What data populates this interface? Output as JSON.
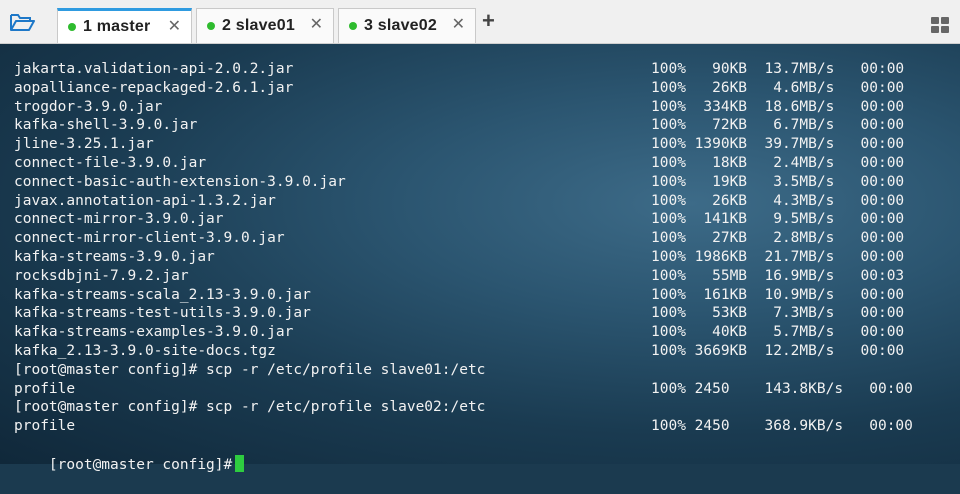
{
  "tabs": [
    {
      "label": "1 master",
      "active": true
    },
    {
      "label": "2 slave01",
      "active": false
    },
    {
      "label": "3 slave02",
      "active": false
    }
  ],
  "terminal": {
    "lines": [
      {
        "name": "jakarta.validation-api-2.0.2.jar",
        "stats": "100%   90KB  13.7MB/s   00:00"
      },
      {
        "name": "aopalliance-repackaged-2.6.1.jar",
        "stats": "100%   26KB   4.6MB/s   00:00"
      },
      {
        "name": "trogdor-3.9.0.jar",
        "stats": "100%  334KB  18.6MB/s   00:00"
      },
      {
        "name": "kafka-shell-3.9.0.jar",
        "stats": "100%   72KB   6.7MB/s   00:00"
      },
      {
        "name": "jline-3.25.1.jar",
        "stats": "100% 1390KB  39.7MB/s   00:00"
      },
      {
        "name": "connect-file-3.9.0.jar",
        "stats": "100%   18KB   2.4MB/s   00:00"
      },
      {
        "name": "connect-basic-auth-extension-3.9.0.jar",
        "stats": "100%   19KB   3.5MB/s   00:00"
      },
      {
        "name": "javax.annotation-api-1.3.2.jar",
        "stats": "100%   26KB   4.3MB/s   00:00"
      },
      {
        "name": "connect-mirror-3.9.0.jar",
        "stats": "100%  141KB   9.5MB/s   00:00"
      },
      {
        "name": "connect-mirror-client-3.9.0.jar",
        "stats": "100%   27KB   2.8MB/s   00:00"
      },
      {
        "name": "kafka-streams-3.9.0.jar",
        "stats": "100% 1986KB  21.7MB/s   00:00"
      },
      {
        "name": "rocksdbjni-7.9.2.jar",
        "stats": "100%   55MB  16.9MB/s   00:03"
      },
      {
        "name": "kafka-streams-scala_2.13-3.9.0.jar",
        "stats": "100%  161KB  10.9MB/s   00:00"
      },
      {
        "name": "kafka-streams-test-utils-3.9.0.jar",
        "stats": "100%   53KB   7.3MB/s   00:00"
      },
      {
        "name": "kafka-streams-examples-3.9.0.jar",
        "stats": "100%   40KB   5.7MB/s   00:00"
      },
      {
        "name": "kafka_2.13-3.9.0-site-docs.tgz",
        "stats": "100% 3669KB  12.2MB/s   00:00"
      },
      {
        "name": "[root@master config]# scp -r /etc/profile slave01:/etc",
        "stats": ""
      },
      {
        "name": "profile",
        "stats": "100% 2450    143.8KB/s   00:00"
      },
      {
        "name": "[root@master config]# scp -r /etc/profile slave02:/etc",
        "stats": ""
      },
      {
        "name": "profile",
        "stats": "100% 2450    368.9KB/s   00:00"
      }
    ],
    "prompt": "[root@master config]#"
  },
  "colors": {
    "accent": "#2f9be0",
    "status_dot": "#2ebb2e",
    "cursor": "#2ecc40"
  },
  "icons": {
    "open_folder": "folder-open-icon",
    "new_tab": "plus-icon",
    "layout": "grid-icon",
    "close": "close-icon"
  }
}
